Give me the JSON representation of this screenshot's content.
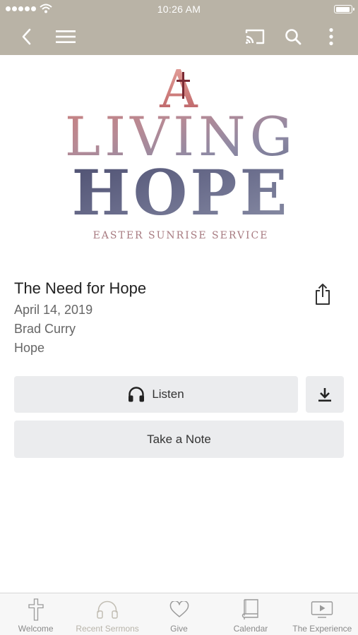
{
  "status_bar": {
    "time": "10:26 AM"
  },
  "nav": {
    "back": "back-icon",
    "menu": "hamburger-menu-icon",
    "cast": "cast-icon",
    "search": "search-icon",
    "more": "more-vertical-icon"
  },
  "artwork": {
    "line1": "A",
    "line2": "LIVING",
    "line3": "HOPE",
    "subtitle": "EASTER SUNRISE SERVICE"
  },
  "sermon": {
    "title": "The Need for Hope",
    "date": "April 14, 2019",
    "speaker": "Brad Curry",
    "series": "Hope"
  },
  "actions": {
    "listen_label": "Listen",
    "note_label": "Take a Note",
    "download_icon": "download-icon",
    "share_icon": "share-icon"
  },
  "tabs": [
    {
      "label": "Welcome",
      "icon": "cross-icon"
    },
    {
      "label": "Recent Sermons",
      "icon": "headphones-icon",
      "active": true
    },
    {
      "label": "Give",
      "icon": "heart-icon"
    },
    {
      "label": "Calendar",
      "icon": "book-icon"
    },
    {
      "label": "The Experience",
      "icon": "video-icon"
    }
  ],
  "colors": {
    "bar": "#b9b3a6",
    "button_bg": "#ebecee",
    "art_pink": "#d38a86",
    "art_slate": "#5d6080"
  }
}
